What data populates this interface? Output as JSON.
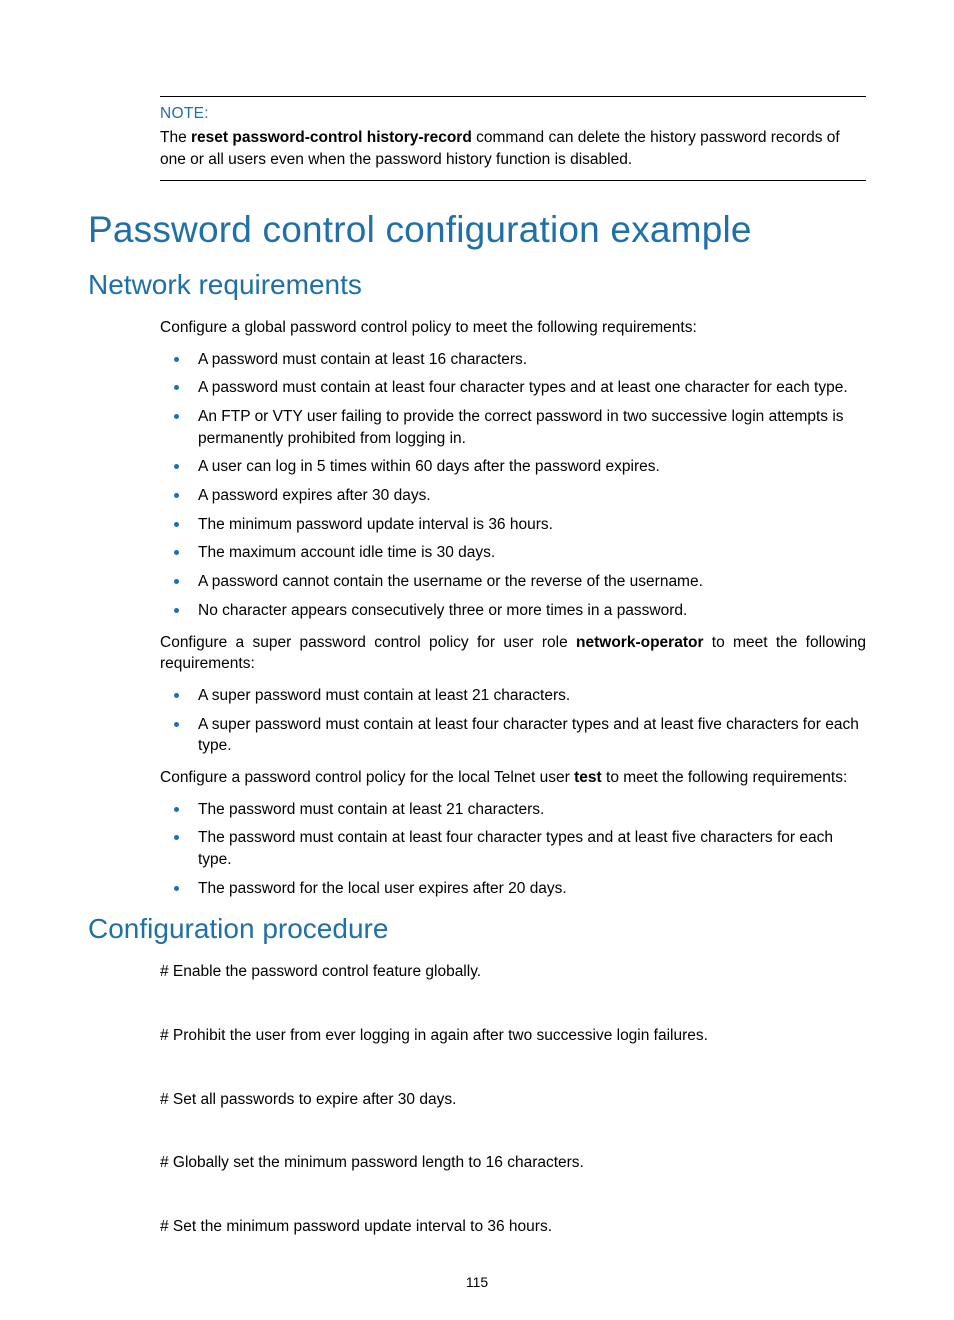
{
  "note": {
    "label": "NOTE:",
    "body_pre": "The ",
    "body_bold": "reset password-control history-record",
    "body_post": " command can delete the history password records of one or all users even when the password history function is disabled."
  },
  "title": "Password control configuration example",
  "section_requirements": "Network requirements",
  "req_intro": "Configure a global password control policy to meet the following requirements:",
  "req_list1": [
    "A password must contain at least 16 characters.",
    "A password must contain at least four character types and at least one character for each type.",
    "An FTP or VTY user failing to provide the correct password in two successive login attempts is permanently prohibited from logging in.",
    "A user can log in 5 times within 60 days after the password expires.",
    "A password expires after 30 days.",
    "The minimum password update interval is 36 hours.",
    "The maximum account idle time is 30 days.",
    "A password cannot contain the username or the reverse of the username.",
    "No character appears consecutively three or more times in a password."
  ],
  "req_super_pre": "Configure a super password control policy for user role ",
  "req_super_bold": "network-operator",
  "req_super_post": " to meet the following requirements:",
  "req_list2": [
    "A super password must contain at least 21 characters.",
    "A super password must contain at least four character types and at least five characters for each type."
  ],
  "req_local_pre": "Configure a password control policy for the local Telnet user ",
  "req_local_bold": "test",
  "req_local_post": " to meet the following requirements:",
  "req_list3": [
    "The password must contain at least 21 characters.",
    "The password must contain at least four character types and at least five characters for each type.",
    "The password for the local user expires after 20 days."
  ],
  "section_procedure": "Configuration procedure",
  "steps": [
    "# Enable the password control feature globally.",
    "# Prohibit the user from ever logging in again after two successive login failures.",
    "# Set all passwords to expire after 30 days.",
    "# Globally set the minimum password length to 16 characters.",
    "# Set the minimum password update interval to 36 hours."
  ],
  "page_number": "115"
}
